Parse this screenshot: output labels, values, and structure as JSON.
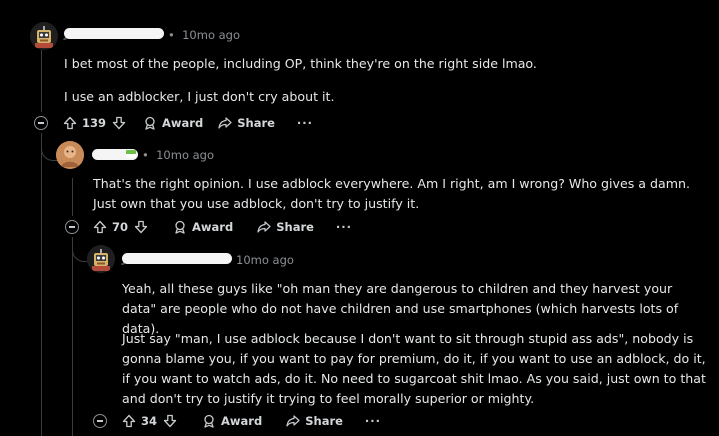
{
  "comments": [
    {
      "time": "10mo ago",
      "paragraphs": [
        "I bet most of the people, including OP, think they're on the right side lmao.",
        "I use an adblocker, I just don't cry about it."
      ],
      "upvotes": "139",
      "award_label": "Award",
      "share_label": "Share",
      "more_label": "···"
    },
    {
      "time": "10mo ago",
      "paragraphs": [
        "That's the right opinion. I use adblock everywhere. Am I right, am I wrong? Who gives a damn. Just own that you use adblock, don't try to justify it."
      ],
      "upvotes": "70",
      "award_label": "Award",
      "share_label": "Share",
      "more_label": "···"
    },
    {
      "time": "10mo ago",
      "paragraphs": [
        "Yeah, all these guys like \"oh man they are dangerous to children and they harvest your data\" are people who do not have children and use smartphones (which harvests lots of data).",
        "Just say \"man, I use adblock because I don't want to sit through stupid ass ads\", nobody is gonna blame you, if you want to pay for premium, do it, if you want to use an adblock, do it, if you want to watch ads, do it. No need to sugarcoat shit lmao. As you said, just own to that and don't try to justify it trying to feel morally superior or mighty."
      ],
      "upvotes": "34",
      "award_label": "Award",
      "share_label": "Share",
      "more_label": "···"
    }
  ],
  "colors": {
    "background": "#000000",
    "text": "#e6e8ea",
    "meta": "#8b9094",
    "rail": "#3a3d40"
  }
}
